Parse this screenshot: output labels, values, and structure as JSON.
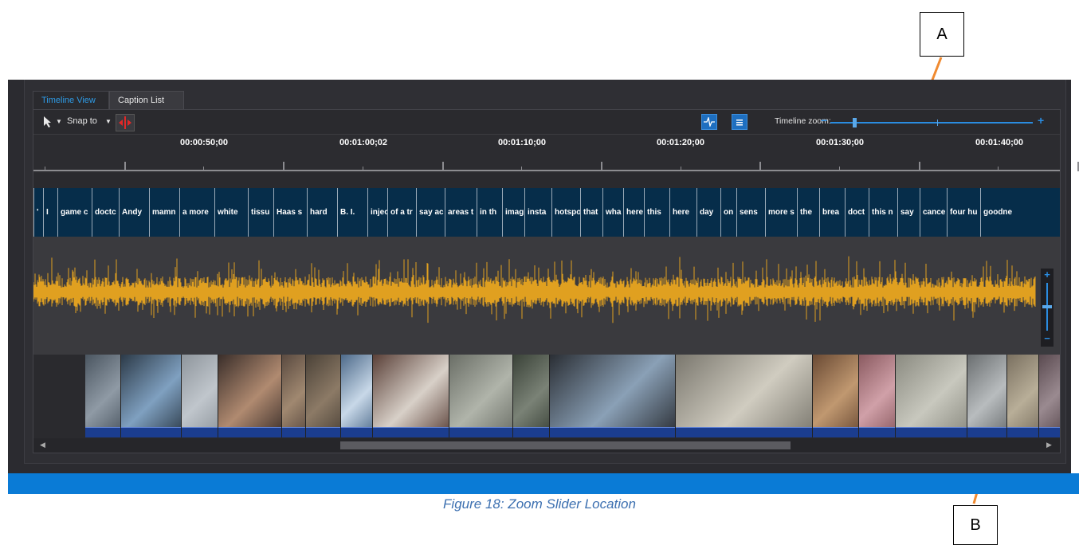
{
  "callouts": {
    "a": "A",
    "b": "B"
  },
  "tabs": [
    {
      "label": "Timeline View",
      "active": true
    },
    {
      "label": "Caption List",
      "active": false
    }
  ],
  "toolbar": {
    "snap_label": "Snap to",
    "zoom_label": "Timeline zoom:",
    "zoom_minus": "−",
    "zoom_plus": "+",
    "zoom_level": 0.12
  },
  "ruler": {
    "timecodes": [
      "00:00:50;00",
      "00:01:00;02",
      "00:01:10;00",
      "00:01:20;00",
      "00:01:30;00",
      "00:01:40;00"
    ]
  },
  "caption_blocks": [
    "'",
    "I",
    "game c",
    "doctc",
    "Andy",
    "mamn",
    "a more",
    "white",
    "tissu",
    "Haas s",
    "hard",
    "B. I.",
    "injec",
    "of a tr",
    "say ac",
    "areas t",
    "in th",
    "imag",
    "insta",
    "hotspo",
    "that",
    "wha",
    "here",
    "this",
    "here",
    "day",
    "on",
    "sens",
    "more s",
    "the",
    "brea",
    "doct",
    "this n",
    "say",
    "cance",
    "four hu",
    "goodne"
  ],
  "waveform": {
    "color": "#e0a020",
    "vertical_zoom_plus": "+",
    "vertical_zoom_minus": "−",
    "vertical_zoom_level": 0.5
  },
  "scroll": {
    "left_arrow": "◀",
    "right_arrow": "▶"
  },
  "figure_caption": "Figure 18: Zoom Slider Location",
  "colors": {
    "accent": "#1e6fc0",
    "caption_bg": "#062d4a",
    "status_bar": "#0a7bd6",
    "callout_arrow": "#f08a30"
  }
}
